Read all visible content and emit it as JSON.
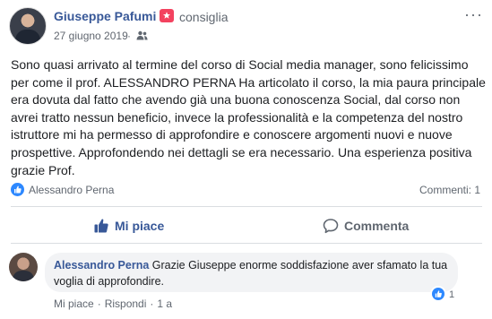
{
  "post": {
    "author": "Giuseppe Pafumi",
    "recommendation": "consiglia",
    "date": "27 giugno 2019",
    "separator": "·",
    "more": "···",
    "text": "Sono quasi arrivato al termine del corso di Social media manager, sono felicissimo per come il prof. ALESSANDRO PERNA Ha articolato il corso, la mia paura principale era dovuta dal fatto che avendo già una buona conoscenza Social, dal corso non avrei tratto nessun beneficio, invece la professionalità e la competenza del nostro istruttore mi ha permesso di approfondire e conoscere argomenti nuovi e nuove prospettive. Approfondendo nei dettagli se era necessario. Una esperienza positiva grazie Prof.",
    "reactor": "Alessandro Perna",
    "comments_count": "Commenti: 1"
  },
  "actions": {
    "like_label": "Mi piace",
    "comment_label": "Commenta"
  },
  "comment": {
    "author": "Alessandro Perna",
    "text": "Grazie Giuseppe enorme soddisfazione aver sfamato la tua voglia di approfondire.",
    "like_count": "1",
    "like_label": "Mi piace",
    "sep1": "·",
    "reply_label": "Rispondi",
    "sep2": "·",
    "time": "1 a"
  },
  "colors": {
    "link": "#385898",
    "like_blue": "#2d88ff",
    "recommend_red": "#f3425f",
    "muted": "#606770"
  }
}
